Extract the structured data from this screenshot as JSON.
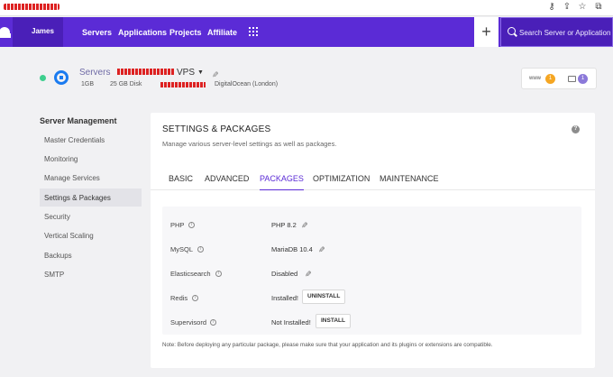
{
  "browser": {
    "icons": [
      "key-icon",
      "share-icon",
      "star-icon",
      "puzzle-icon"
    ]
  },
  "topnav": {
    "user": "James",
    "links": [
      "Servers",
      "Applications",
      "Projects",
      "Affiliate"
    ],
    "add_label": "+",
    "search_placeholder": "Search Server or Application"
  },
  "server": {
    "name_prefix": "Servers",
    "name_suffix": "VPS",
    "ram": "1GB",
    "disk": "25 GB Disk",
    "provider": "DigitalOcean (London)",
    "status_color": "#3ecf8e",
    "www_label": "www",
    "www_count": "1",
    "app_count": "1"
  },
  "sidebar": {
    "title": "Server Management",
    "items": [
      {
        "label": "Master Credentials",
        "active": false
      },
      {
        "label": "Monitoring",
        "active": false
      },
      {
        "label": "Manage Services",
        "active": false
      },
      {
        "label": "Settings & Packages",
        "active": true
      },
      {
        "label": "Security",
        "active": false
      },
      {
        "label": "Vertical Scaling",
        "active": false
      },
      {
        "label": "Backups",
        "active": false
      },
      {
        "label": "SMTP",
        "active": false
      }
    ]
  },
  "panel": {
    "title": "SETTINGS & PACKAGES",
    "subtitle": "Manage various server-level settings as well as packages.",
    "help": "?",
    "tabs": [
      {
        "label": "BASIC",
        "active": false
      },
      {
        "label": "ADVANCED",
        "active": false
      },
      {
        "label": "PACKAGES",
        "active": true
      },
      {
        "label": "OPTIMIZATION",
        "active": false
      },
      {
        "label": "MAINTENANCE",
        "active": false
      }
    ],
    "packages": [
      {
        "name": "PHP",
        "value": "PHP 8.2",
        "action": "edit"
      },
      {
        "name": "MySQL",
        "value": "MariaDB 10.4",
        "action": "edit"
      },
      {
        "name": "Elasticsearch",
        "value": "Disabled",
        "action": "edit"
      },
      {
        "name": "Redis",
        "value": "Installed!",
        "action": "button",
        "button": "UNINSTALL"
      },
      {
        "name": "Supervisord",
        "value": "Not Installed!",
        "action": "button",
        "button": "INSTALL"
      }
    ],
    "note": "Note: Before deploying any particular package, please make sure that your application and its plugins or extensions are compatible."
  },
  "colors": {
    "brand": "#5b2bd6",
    "brand_dark": "#4a1fb8",
    "badge_orange": "#f5a623",
    "badge_purple": "#8b79d9"
  }
}
